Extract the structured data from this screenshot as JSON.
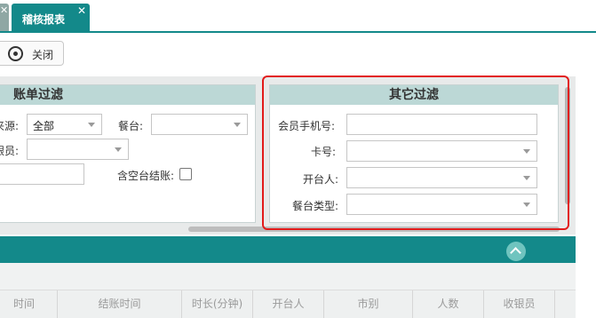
{
  "tabs": {
    "close_glyph": "✕",
    "active_label": "稽核报表"
  },
  "toolbar": {
    "close_label": "关闭"
  },
  "bill_filter": {
    "title": "账单过滤",
    "source_label": "来源:",
    "source_value": "全部",
    "table_label": "餐台:",
    "cashier_label": "银员:",
    "empty_table_label": "含空台结账:"
  },
  "other_filter": {
    "title": "其它过滤",
    "member_phone_label": "会员手机号:",
    "card_label": "卡号:",
    "opener_label": "开台人:",
    "table_type_label": "餐台类型:"
  },
  "grid": {
    "columns": [
      "时间",
      "结账时间",
      "时长(分钟)",
      "开台人",
      "市别",
      "人数",
      "收银员"
    ]
  },
  "colors": {
    "accent": "#13898a",
    "panel_header": "#bcd8d6",
    "highlight_border": "#e21b1b"
  }
}
